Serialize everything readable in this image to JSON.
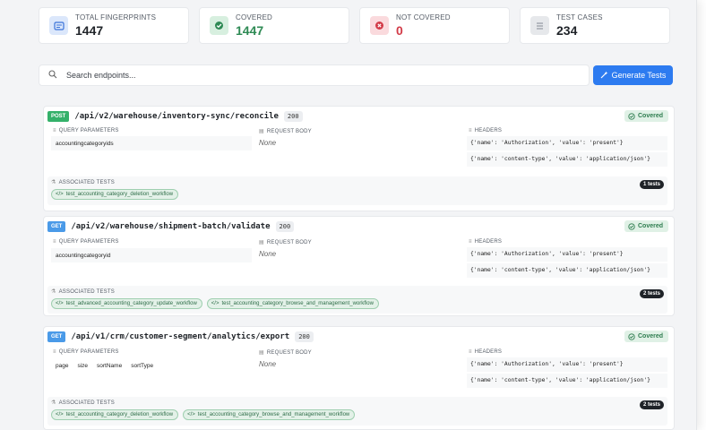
{
  "stats": [
    {
      "label": "TOTAL FINGERPRINTS",
      "value": "1447",
      "icon": "fingerprint-icon"
    },
    {
      "label": "COVERED",
      "value": "1447",
      "icon": "check-icon"
    },
    {
      "label": "NOT COVERED",
      "value": "0",
      "icon": "x-circle-icon"
    },
    {
      "label": "TEST CASES",
      "value": "234",
      "icon": "list-icon"
    }
  ],
  "search": {
    "placeholder": "Search endpoints..."
  },
  "generate_button": "Generate Tests",
  "labels": {
    "query_parameters": "QUERY PARAMETERS",
    "request_body": "REQUEST BODY",
    "headers": "HEADERS",
    "associated_tests": "ASSOCIATED TESTS",
    "covered": "Covered",
    "none": "None"
  },
  "endpoints": [
    {
      "method": "POST",
      "path": "/api/v2/warehouse/inventory-sync/reconcile",
      "status": "200",
      "params": [
        "accountingcategoryids"
      ],
      "headers": [
        "{'name': 'Authorization', 'value': 'present'}",
        "{'name': 'content-type', 'value': 'application/json'}"
      ],
      "tests_count": "1 tests",
      "tests": [
        "test_accounting_category_deletion_workflow"
      ]
    },
    {
      "method": "GET",
      "path": "/api/v2/warehouse/shipment-batch/validate",
      "status": "200",
      "params": [
        "accountingcategoryid"
      ],
      "headers": [
        "{'name': 'Authorization', 'value': 'present'}",
        "{'name': 'content-type', 'value': 'application/json'}"
      ],
      "tests_count": "2 tests",
      "tests": [
        "test_advanced_accounting_category_update_workflow",
        "test_accounting_category_browse_and_management_workflow"
      ]
    },
    {
      "method": "GET",
      "path": "/api/v1/crm/customer-segment/analytics/export",
      "status": "200",
      "params": [
        "page",
        "size",
        "sortName",
        "sortType"
      ],
      "headers": [
        "{'name': 'Authorization', 'value': 'present'}",
        "{'name': 'content-type', 'value': 'application/json'}"
      ],
      "tests_count": "2 tests",
      "tests": [
        "test_accounting_category_deletion_workflow",
        "test_accounting_category_browse_and_management_workflow"
      ]
    }
  ]
}
